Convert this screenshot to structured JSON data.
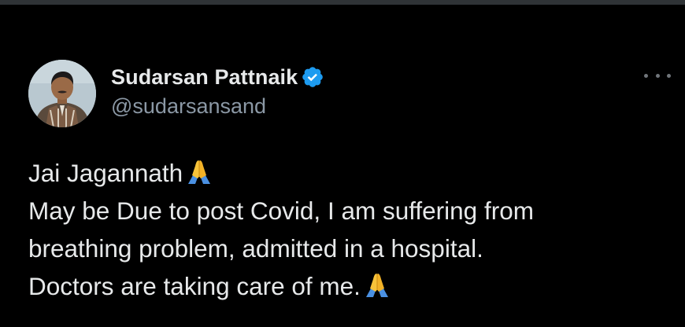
{
  "author": {
    "display_name": "Sudarsan Pattnaik",
    "handle": "@sudarsansand",
    "verified": true
  },
  "icons": {
    "avatar": "profile-photo",
    "verified": "verified-badge-icon",
    "more": "more-options-icon",
    "emoji": "folded-hands-emoji"
  },
  "tweet": {
    "lines": [
      "Jai Jagannath",
      "May be Due to post Covid, I am suffering from",
      "breathing problem, admitted in a hospital.",
      "Doctors are taking care of me."
    ]
  },
  "colors": {
    "background": "#000000",
    "text": "#e7e9ea",
    "secondary_text": "#8b98a5",
    "verified_blue": "#1d9bf0",
    "emoji_yellow": "#f7c33a"
  }
}
